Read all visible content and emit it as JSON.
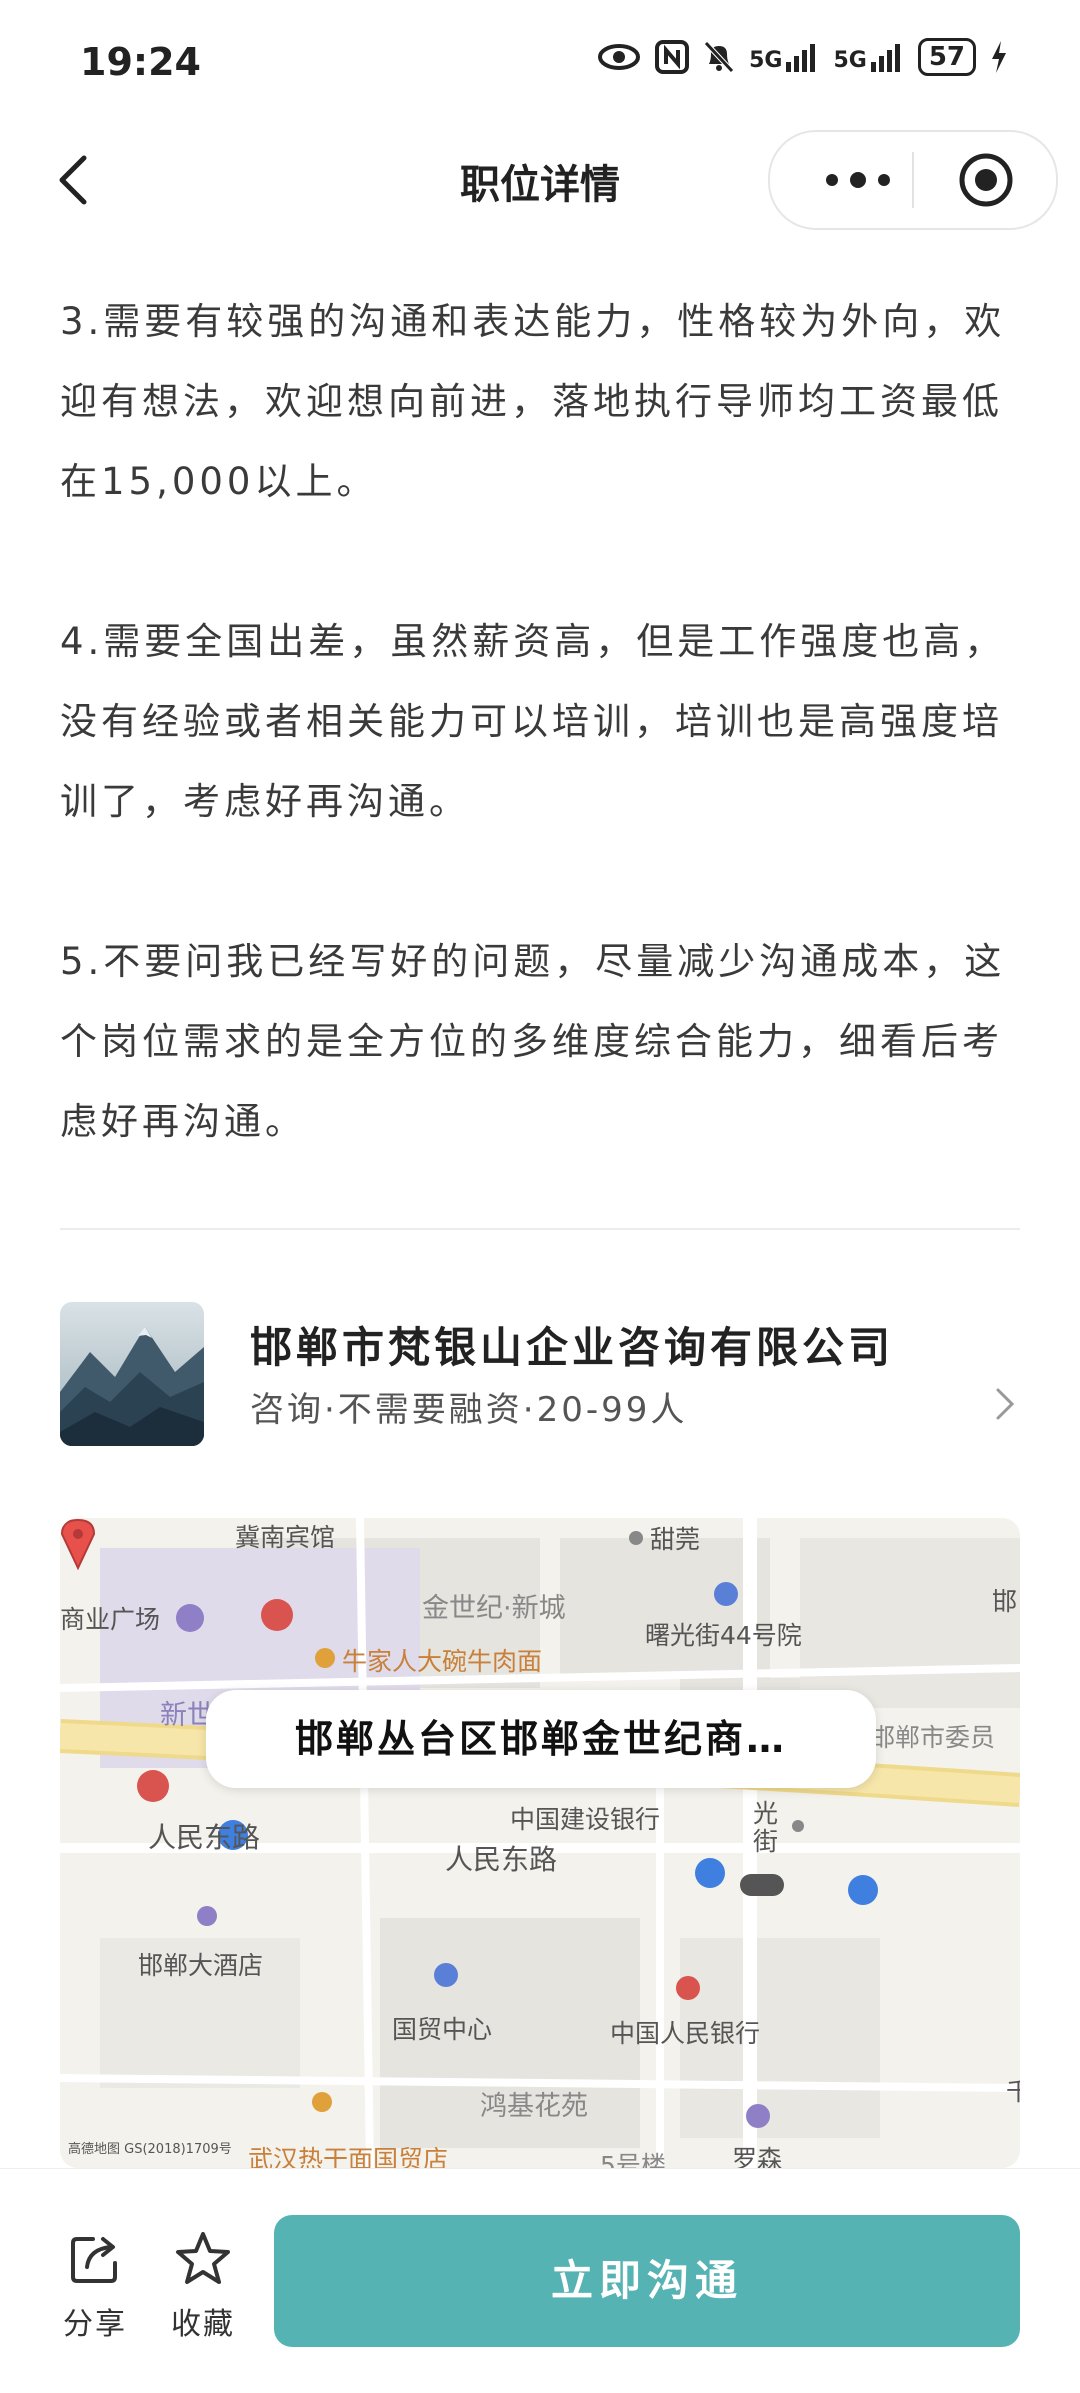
{
  "status_bar": {
    "time": "19:24",
    "icons": [
      "eye-icon",
      "nfc-icon",
      "mute-bell-icon",
      "signal-5g-icon",
      "signal-5g-icon",
      "battery-icon",
      "charging-icon"
    ],
    "signal_1": "5G",
    "signal_2": "5G",
    "battery": "57"
  },
  "nav": {
    "title": "职位详情",
    "back_icon": "chevron-left-icon",
    "more_icon": "more-dots-icon",
    "close_icon": "target-circle-icon"
  },
  "description": {
    "paragraphs": [
      "3.需要有较强的沟通和表达能力，性格较为外向，欢迎有想法，欢迎想向前进，落地执行导师均工资最低在15,000以上。",
      "4.需要全国出差，虽然薪资高，但是工作强度也高，没有经验或者相关能力可以培训，培训也是高强度培训了，考虑好再沟通。",
      "5.不要问我已经写好的问题，尽量减少沟通成本，这个岗位需求的是全方位的多维度综合能力，细看后考虑好再沟通。"
    ]
  },
  "company": {
    "name": "邯郸市梵银山企业咨询有限公司",
    "meta": "咨询·不需要融资·20-99人",
    "logo_icon": "mountain-landscape-icon",
    "chevron_icon": "chevron-right-icon"
  },
  "map": {
    "address": "邯郸丛台区邯郸金世纪商…",
    "labels": {
      "l1": "冀南宾馆",
      "l2": "甜莞",
      "l3": "金世纪·新城",
      "l4": "商业广场",
      "l5": "曙光街44号院",
      "l6": "邯",
      "l7": "牛家人大碗牛肉面",
      "l8": "新世",
      "l9": "邯郸市委员",
      "l10": "中国建设银行",
      "l11": "光",
      "l12": "街",
      "l13": "人民东路",
      "l14": "人民东路",
      "l15": "邯郸大酒店",
      "l16": "国贸中心",
      "l17": "中国人民银行",
      "l18": "鸿基花苑",
      "l19": "千",
      "l20": "武汉热干面国贸店",
      "l21": "5号楼",
      "l22": "罗森"
    },
    "attribution": "高德地图 GS(2018)1709号",
    "colors": {
      "road": "#f3e3a6",
      "district": "#e0dbeb",
      "pin": "#e8504b"
    }
  },
  "bottom_bar": {
    "share_label": "分享",
    "favorite_label": "收藏",
    "chat_label": "立即沟通",
    "share_icon": "share-icon",
    "favorite_icon": "star-icon",
    "chat_color": "#56b3b4"
  }
}
